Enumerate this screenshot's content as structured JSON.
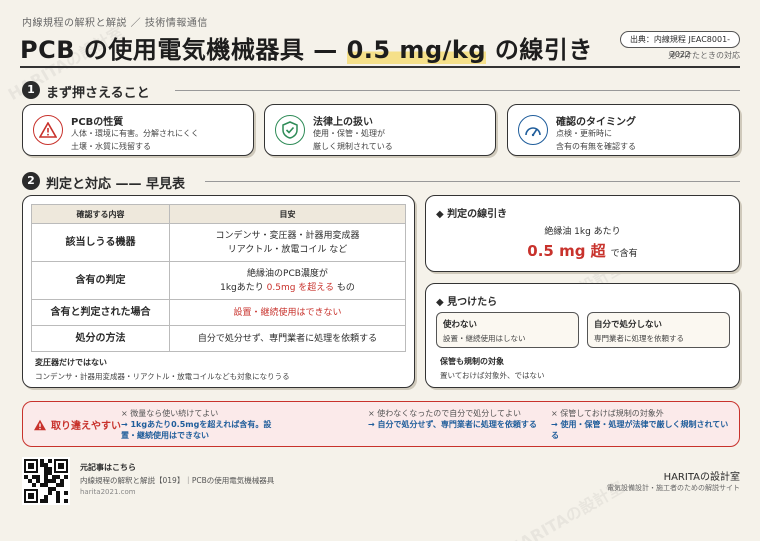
{
  "header": {
    "kicker": "内線規程の解釈と解説 ／ 技術情報通信",
    "title_a": "PCB の使用電気機械器具 — ",
    "title_hl": "0.5 mg/kg",
    "title_b": " の線引き",
    "source": "出典：内線規程 JEAC8001-2022",
    "source_note": "見つけたときの対応"
  },
  "section1": {
    "num": "1",
    "title": "まず押さえること",
    "cards": [
      {
        "title": "PCBの性質",
        "line1": "人体・環境に有害。分解されにくく",
        "line2": "土壌・水質に残留する",
        "color": "#c8322c"
      },
      {
        "title": "法律上の扱い",
        "line1": "使用・保管・処理が",
        "line2": "厳しく規制されている",
        "color": "#2e8b57"
      },
      {
        "title": "確認のタイミング",
        "line1": "点検・更新時に",
        "line2": "含有の有無を確認する",
        "color": "#1f5d9b"
      }
    ]
  },
  "section2": {
    "num": "2",
    "title": "判定と対応 —— 早見表",
    "table": {
      "headers": [
        "確認する内容",
        "目安"
      ],
      "rows": [
        {
          "label": "該当しうる機器",
          "v1": "コンデンサ・変圧器・計器用変成器",
          "v2": "リアクトル・放電コイル など",
          "v2r": ""
        },
        {
          "label": "含有の判定",
          "v1": "絶縁油のPCB濃度が",
          "v2": "1kgあたり ",
          "v2r": "0.5mg を超える",
          "v2s": " もの"
        },
        {
          "label": "含有と判定された場合",
          "v1": "",
          "v1r": "設置・継続使用はできない"
        },
        {
          "label": "処分の方法",
          "v1": "自分で処分せず、専門業者に処理を依頼する"
        }
      ],
      "note_title": "変圧器だけではない",
      "note_text": "コンデンサ・計器用変成器・リアクトル・放電コイルなども対象になりうる"
    },
    "threshold": {
      "title": "判定の線引き",
      "sub": "絶縁油 1kg あたり",
      "value": "0.5 mg",
      "over": "超",
      "suffix": "で含有"
    },
    "found": {
      "title": "見つけたら",
      "box1_title": "使わない",
      "box1_text": "設置・継続使用はしない",
      "box2_title": "自分で処分しない",
      "box2_text": "専門業者に処理を依頼する",
      "note_title": "保管も規制の対象",
      "note_text": "置いておけば対象外、ではない"
    }
  },
  "mistakes": {
    "label": "取り違えやすい",
    "items": [
      {
        "x": "微量なら使い続けてよい",
        "fix": "→ 1kgあたり0.5mgを超えれば含有。設置・継続使用はできない"
      },
      {
        "x": "使わなくなったので自分で処分してよい",
        "fix": "→ 自分で処分せず、専門業者に処理を依頼する"
      },
      {
        "x": "保管しておけば規制の対象外",
        "fix": "→ 使用・保管・処理が法律で厳しく規制されている"
      }
    ]
  },
  "footer": {
    "orig_label": "元記事はこちら",
    "orig_title": "内線規程の解釈と解説【019】｜PCBの使用電気機械器具",
    "url": "harita2021.com",
    "brand": "HARITAの設計室",
    "brand_sub": "電気設備設計・施工者のための解説サイト"
  },
  "watermark": "HARITAの設計室",
  "colors": {
    "accent_red": "#c8322c",
    "accent_green": "#2e8b57",
    "accent_blue": "#1f5d9b",
    "highlight": "#f5e08a"
  }
}
